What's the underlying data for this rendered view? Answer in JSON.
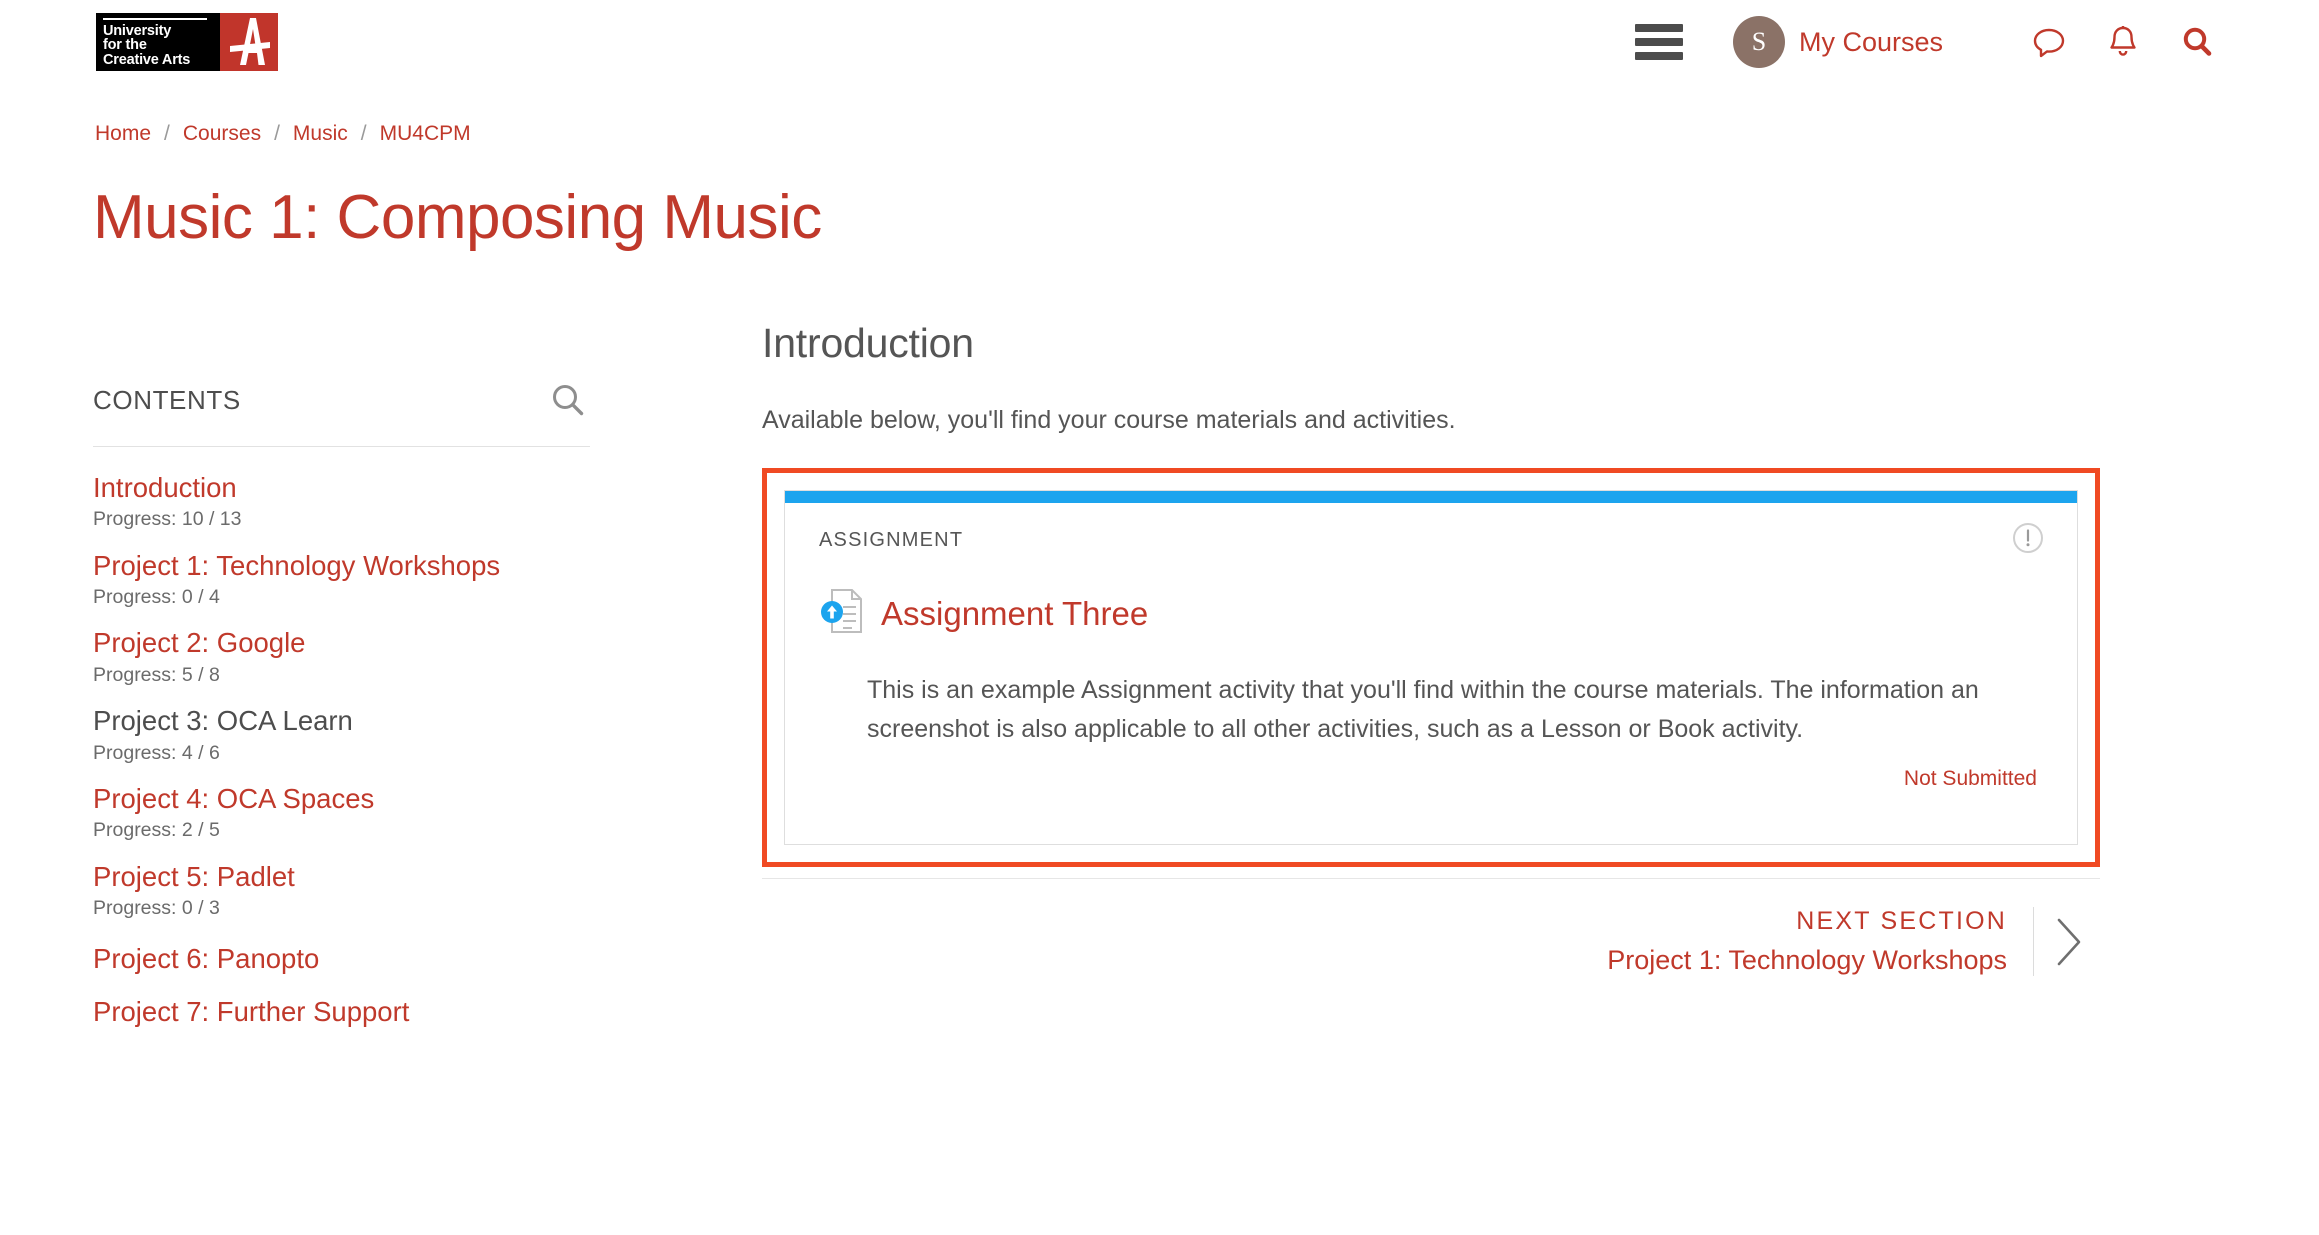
{
  "header": {
    "logo": {
      "line1": "University",
      "line2": "for the",
      "line3": "Creative Arts",
      "mark_letter": "A"
    },
    "menu_icon": "hamburger-menu-icon",
    "avatar_initial": "S",
    "my_courses_label": "My Courses",
    "icons": [
      "message-icon",
      "notifications-bell-icon",
      "search-icon"
    ]
  },
  "breadcrumb": {
    "separator": "/",
    "items": [
      {
        "label": "Home"
      },
      {
        "label": "Courses"
      },
      {
        "label": "Music"
      },
      {
        "label": "MU4CPM"
      }
    ]
  },
  "page": {
    "title": "Music 1: Composing Music"
  },
  "sidebar": {
    "heading": "CONTENTS",
    "search_icon": "search-icon",
    "items": [
      {
        "label": "Introduction",
        "progress": "Progress: 10 / 13",
        "current": false
      },
      {
        "label": "Project 1: Technology Workshops",
        "progress": "Progress: 0 / 4",
        "current": false
      },
      {
        "label": "Project 2: Google",
        "progress": "Progress: 5 / 8",
        "current": false
      },
      {
        "label": "Project 3: OCA Learn",
        "progress": "Progress: 4 / 6",
        "current": true
      },
      {
        "label": "Project 4: OCA Spaces",
        "progress": "Progress: 2 / 5",
        "current": false
      },
      {
        "label": "Project 5: Padlet",
        "progress": "Progress: 0 / 3",
        "current": false
      },
      {
        "label": "Project 6: Panopto",
        "progress": "",
        "current": false
      },
      {
        "label": "Project 7: Further Support",
        "progress": "",
        "current": false
      }
    ]
  },
  "main": {
    "section_title": "Introduction",
    "section_intro": "Available below, you'll find your course materials and activities.",
    "activity_card": {
      "kicker": "ASSIGNMENT",
      "info_icon": "info-exclamation-icon",
      "activity_icon": "assignment-upload-document-icon",
      "title": "Assignment Three",
      "description": "This is an example Assignment activity that you'll find within the course materials. The information an screenshot is also applicable to all other activities, such as a Lesson or Book activity.",
      "status": "Not Submitted",
      "accent_color": "#1ca4ee",
      "highlight_color": "#f04a23"
    }
  },
  "next_section": {
    "label": "NEXT SECTION",
    "name": "Project 1: Technology Workshops",
    "arrow_icon": "chevron-right-icon"
  },
  "colors": {
    "brand_red": "#c0392b",
    "text_gray": "#555555",
    "avatar_brown": "#8b7267"
  }
}
